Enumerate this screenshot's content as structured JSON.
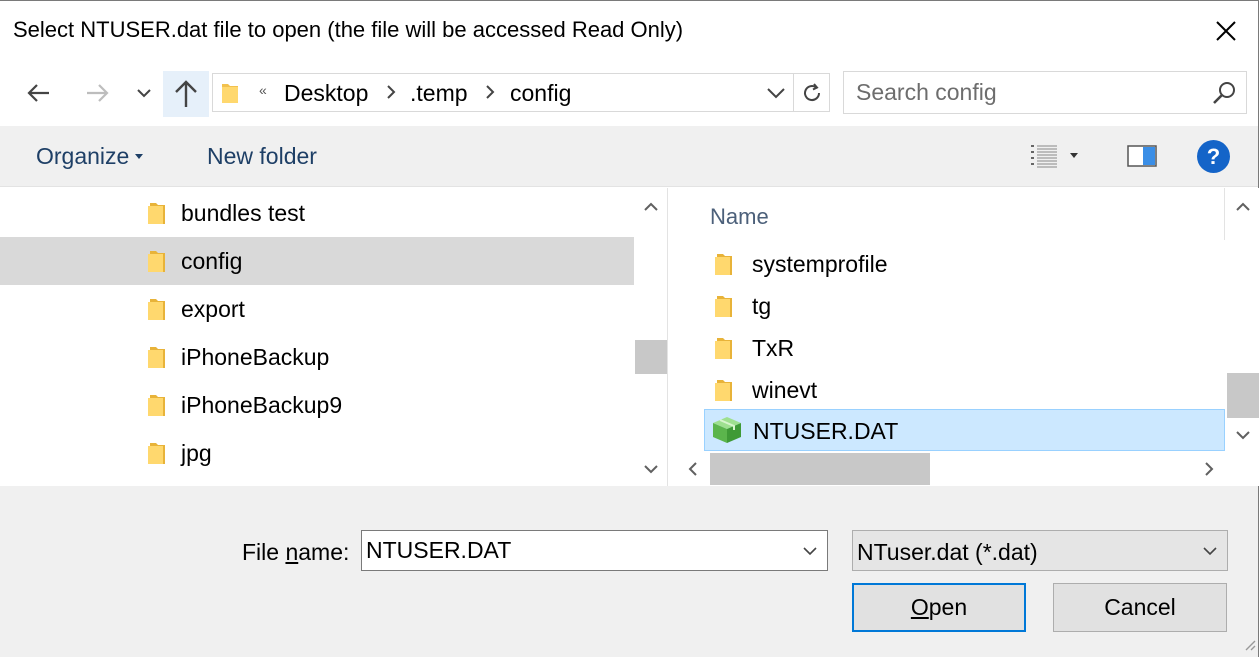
{
  "dialog": {
    "title": "Select NTUSER.dat file to open (the file will be accessed Read Only)"
  },
  "nav": {
    "overflow": "«",
    "breadcrumbs": [
      "Desktop",
      ".temp",
      "config"
    ]
  },
  "search": {
    "placeholder": "Search config"
  },
  "toolbar": {
    "organize_label": "Organize",
    "new_folder_label": "New folder",
    "help_label": "?"
  },
  "tree": {
    "items": [
      {
        "label": "bundles test",
        "selected": false
      },
      {
        "label": "config",
        "selected": true
      },
      {
        "label": "export",
        "selected": false
      },
      {
        "label": "iPhoneBackup",
        "selected": false
      },
      {
        "label": "iPhoneBackup9",
        "selected": false
      },
      {
        "label": "jpg",
        "selected": false
      }
    ]
  },
  "filelist": {
    "column_name": "Name",
    "items": [
      {
        "label": "systemprofile",
        "type": "folder",
        "selected": false
      },
      {
        "label": "tg",
        "type": "folder",
        "selected": false
      },
      {
        "label": "TxR",
        "type": "folder",
        "selected": false
      },
      {
        "label": "winevt",
        "type": "folder",
        "selected": false
      },
      {
        "label": "NTUSER.DAT",
        "type": "file",
        "selected": true
      }
    ]
  },
  "filename": {
    "label_pre": "File ",
    "label_accel": "n",
    "label_post": "ame:",
    "value": "NTUSER.DAT"
  },
  "filetype": {
    "selected": "NTuser.dat (*.dat)"
  },
  "buttons": {
    "open_accel": "O",
    "open_rest": "pen",
    "cancel": "Cancel"
  },
  "colors": {
    "accent": "#0078d7",
    "selection_bg": "#cce8ff",
    "tree_selection_bg": "#d9d9d9",
    "link_text": "#1e3f66",
    "help_blue": "#1464c8"
  }
}
